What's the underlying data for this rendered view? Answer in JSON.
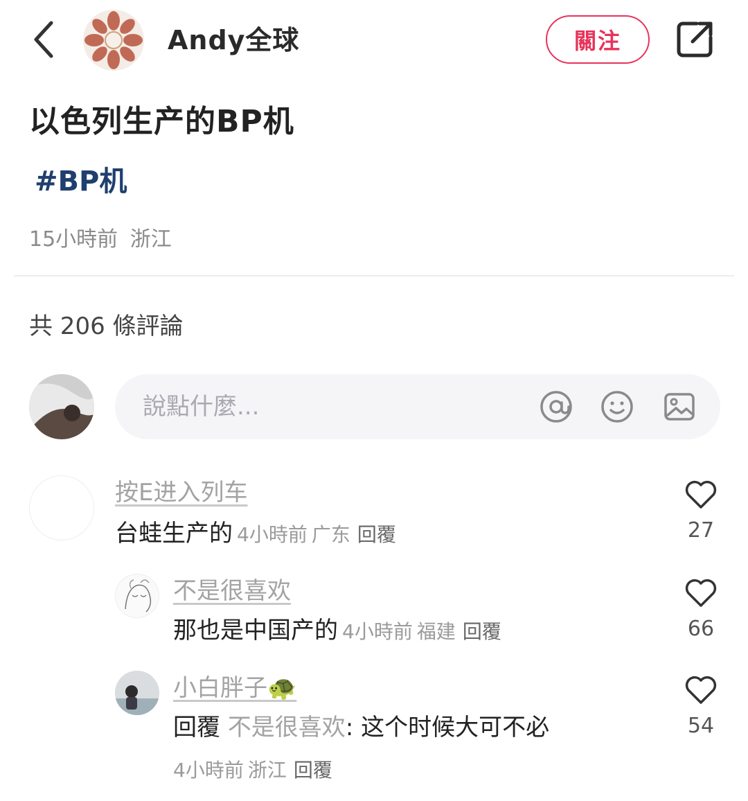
{
  "header": {
    "author_name": "Andy全球",
    "follow_label": "關注"
  },
  "post": {
    "title": "以色列生产的BP机",
    "hashtag": "#BP机",
    "time": "15小時前",
    "location": "浙江"
  },
  "comments_section": {
    "count_label": "共 206 條評論",
    "input_placeholder": "說點什麼..."
  },
  "comments": [
    {
      "user": "按E进入列车",
      "text": "台蛙生产的",
      "time": "4小時前",
      "location": "广东",
      "reply_label": "回覆",
      "likes": "27"
    },
    {
      "user": "不是很喜欢",
      "text": "那也是中国产的",
      "time": "4小時前",
      "location": "福建",
      "reply_label": "回覆",
      "likes": "66"
    },
    {
      "user": "小白胖子🐢",
      "reply_prefix": "回覆",
      "reply_to": "不是很喜欢",
      "text": ": 这个时候大可不必",
      "time": "4小時前",
      "location": "浙江",
      "reply_label": "回覆",
      "likes": "54"
    }
  ],
  "icons": {
    "back": "chevron-left-icon",
    "share": "share-icon",
    "mention": "at-icon",
    "emoji": "emoji-icon",
    "image": "image-icon",
    "like": "heart-icon"
  },
  "colors": {
    "accent": "#e8335a",
    "hashtag": "#1f3f6e",
    "muted": "#8a8a8a",
    "input_bg": "#f5f5f7"
  }
}
